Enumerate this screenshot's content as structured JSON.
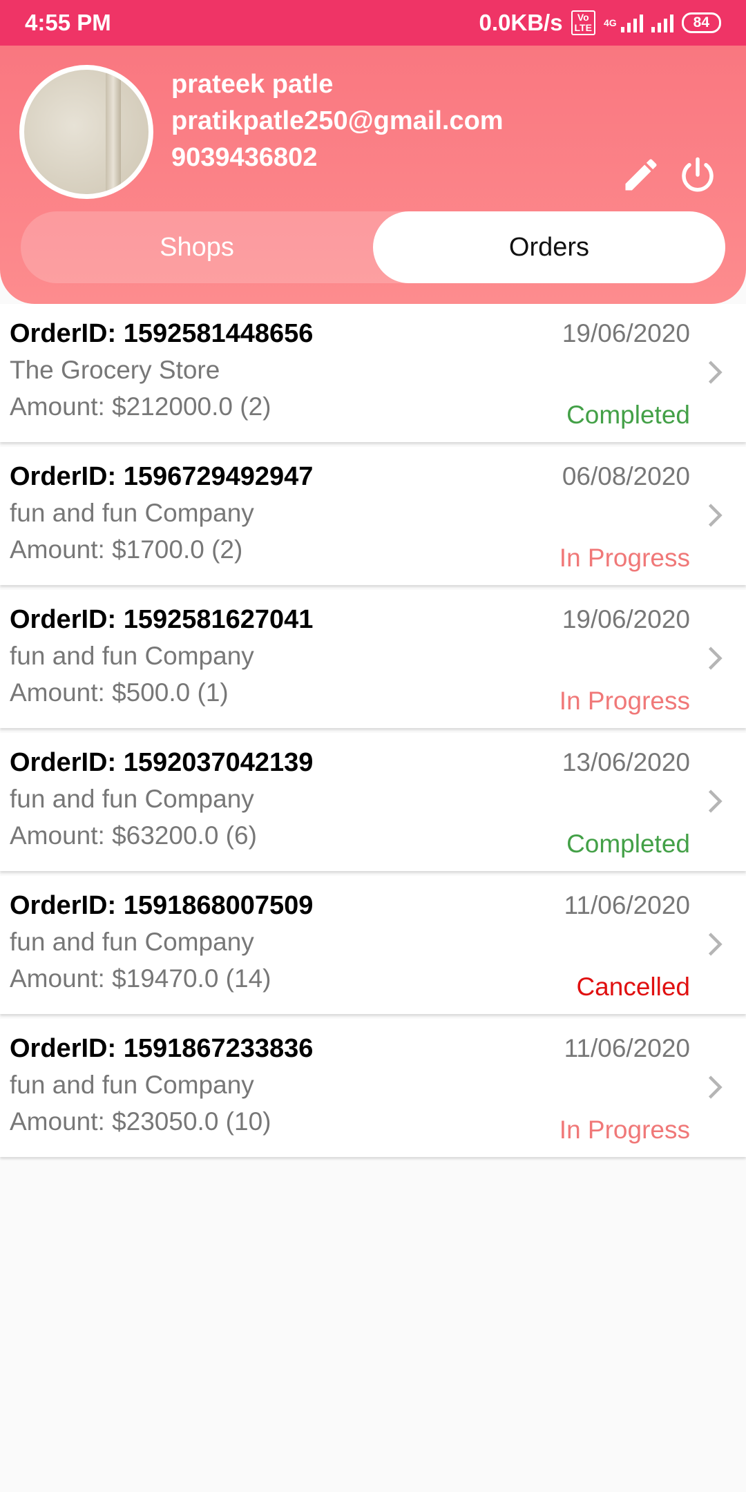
{
  "status_bar": {
    "time": "4:55 PM",
    "network_speed": "0.0KB/s",
    "volte_label": "Vo\nLTE",
    "network_type": "4G",
    "battery": "84"
  },
  "profile": {
    "name": "prateek patle",
    "email": "pratikpatle250@gmail.com",
    "phone": "9039436802"
  },
  "icons": {
    "edit": "pencil-icon",
    "power": "power-icon",
    "chevron": "chevron-right-icon"
  },
  "tabs": {
    "shops": "Shops",
    "orders": "Orders",
    "selected": "Orders"
  },
  "colors": {
    "status_bar": "#ef3466",
    "header": "#fd8c8e",
    "completed": "#43a047",
    "in_progress": "#f07878",
    "cancelled": "#e01010"
  },
  "orders": [
    {
      "order_id": "OrderID: 1592581448656",
      "store": "The Grocery Store",
      "amount": "Amount: $212000.0 (2)",
      "date": "19/06/2020",
      "status": "Completed",
      "status_key": "completed"
    },
    {
      "order_id": "OrderID: 1596729492947",
      "store": "fun and fun Company",
      "amount": "Amount: $1700.0 (2)",
      "date": "06/08/2020",
      "status": "In Progress",
      "status_key": "in_progress"
    },
    {
      "order_id": "OrderID: 1592581627041",
      "store": "fun and fun Company",
      "amount": "Amount: $500.0 (1)",
      "date": "19/06/2020",
      "status": "In Progress",
      "status_key": "in_progress"
    },
    {
      "order_id": "OrderID: 1592037042139",
      "store": "fun and fun Company",
      "amount": "Amount: $63200.0 (6)",
      "date": "13/06/2020",
      "status": "Completed",
      "status_key": "completed"
    },
    {
      "order_id": "OrderID: 1591868007509",
      "store": "fun and fun Company",
      "amount": "Amount: $19470.0 (14)",
      "date": "11/06/2020",
      "status": "Cancelled",
      "status_key": "cancelled"
    },
    {
      "order_id": "OrderID: 1591867233836",
      "store": "fun and fun Company",
      "amount": "Amount: $23050.0 (10)",
      "date": "11/06/2020",
      "status": "In Progress",
      "status_key": "in_progress"
    }
  ]
}
